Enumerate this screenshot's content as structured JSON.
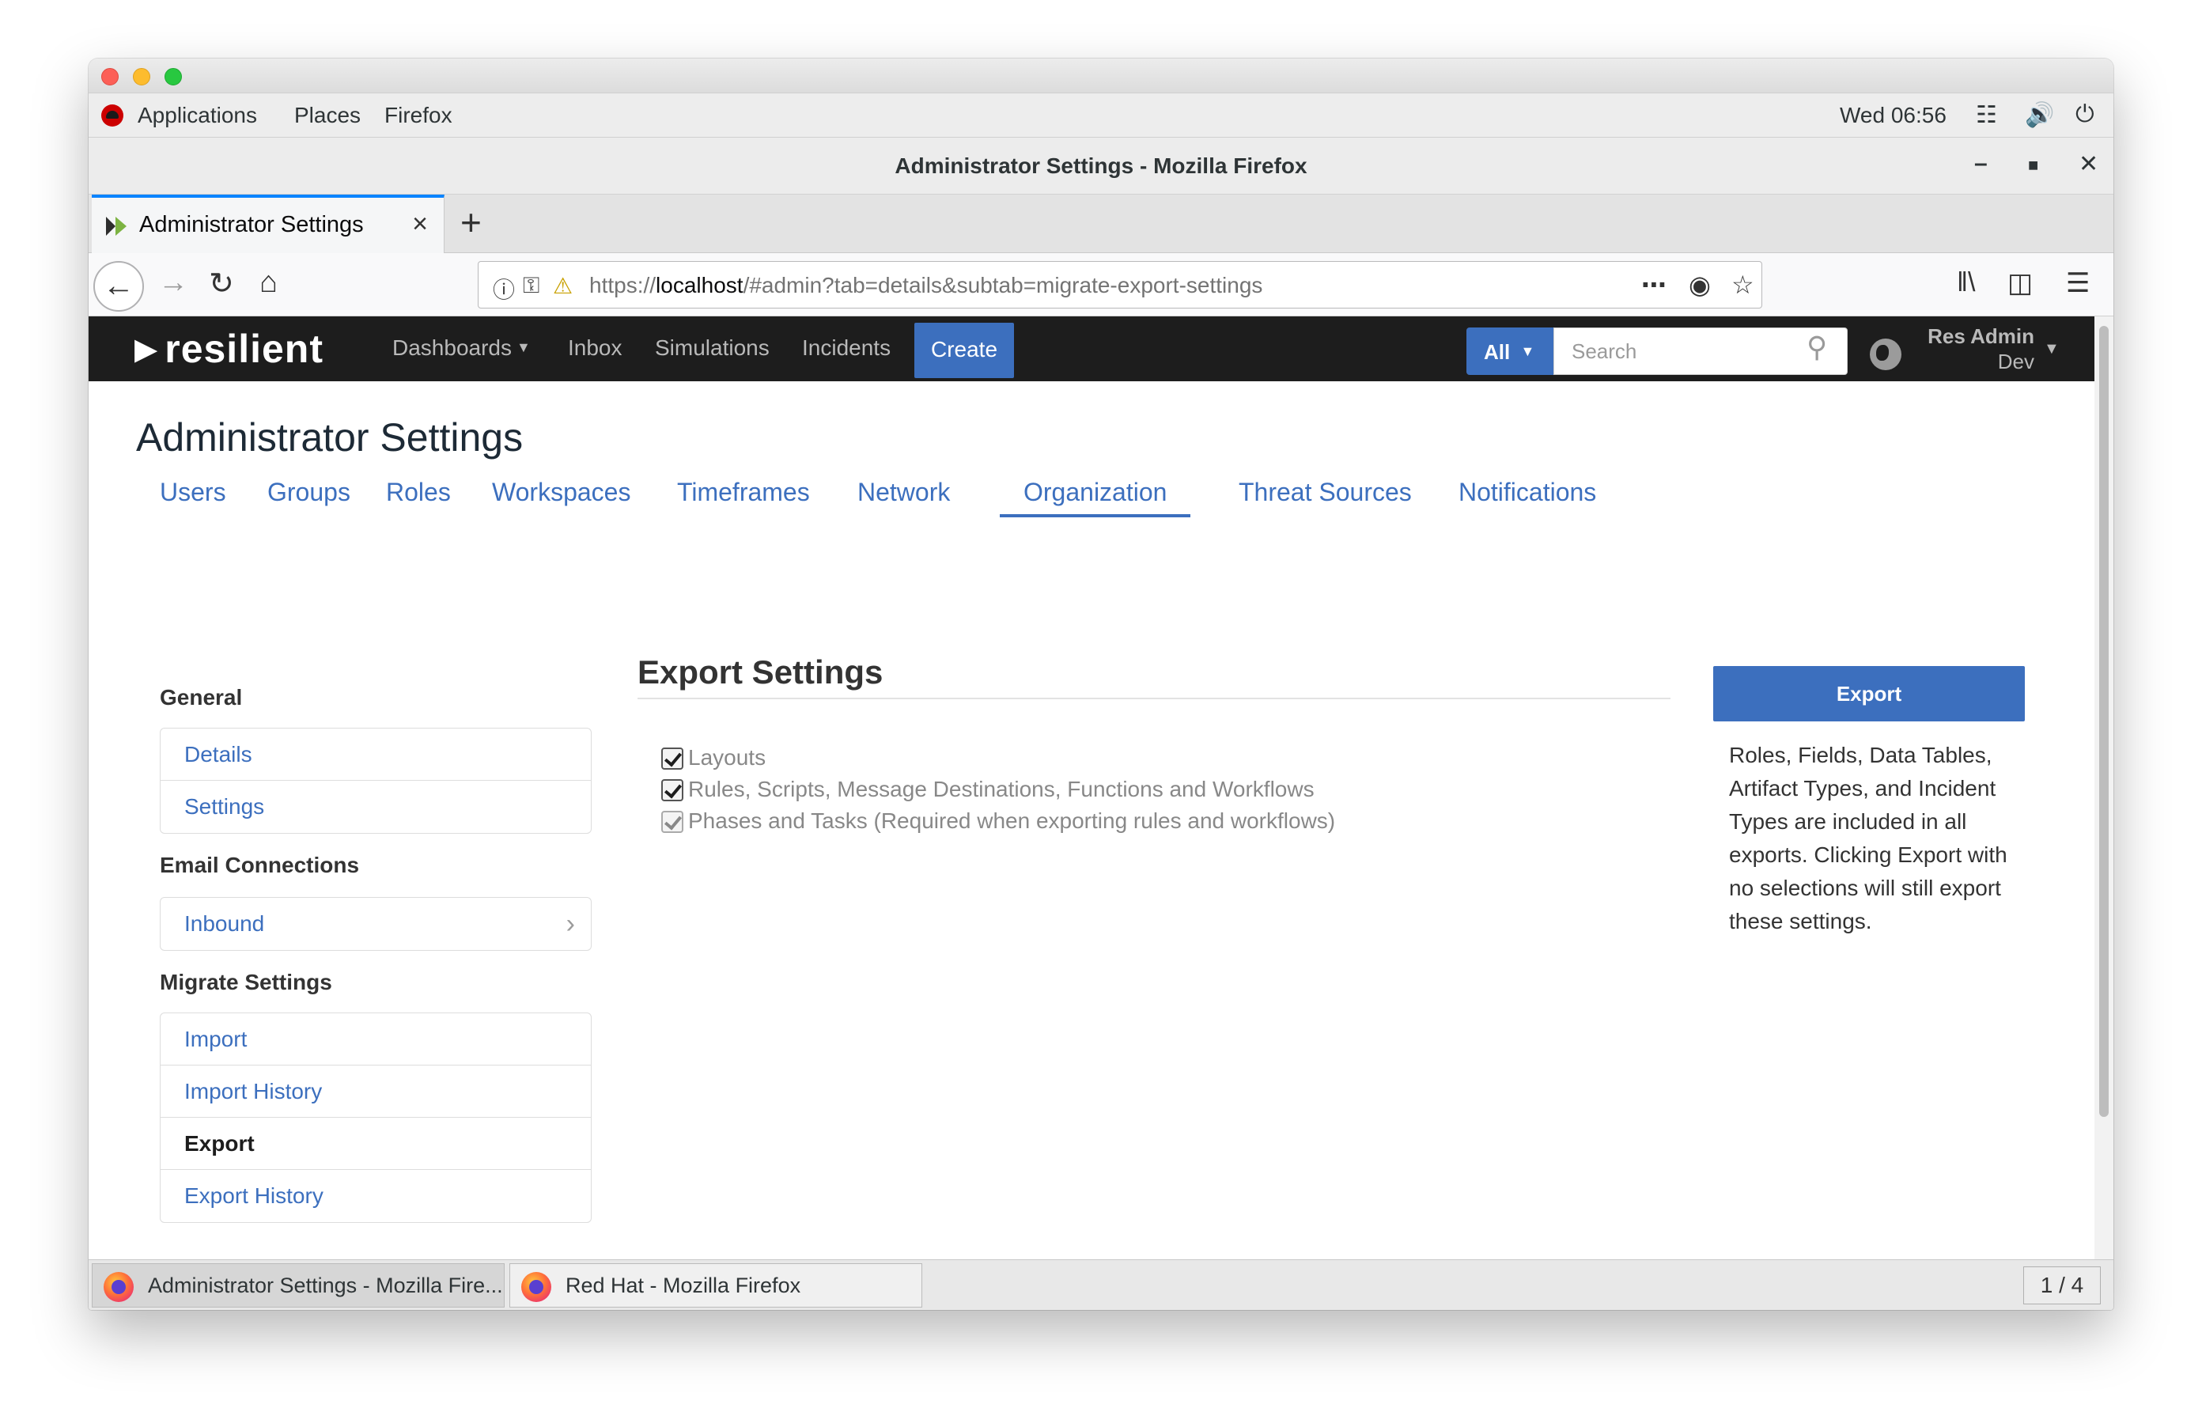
{
  "colors": {
    "accent": "#3c6fbe",
    "header_bg": "#1d1d1d",
    "traffic_red": "#fc5f57",
    "traffic_yellow": "#fdbc2e",
    "traffic_green": "#28c840"
  },
  "gnome": {
    "applications": "Applications",
    "places": "Places",
    "firefox": "Firefox",
    "clock": "Wed 06:56",
    "icons": [
      "network-icon",
      "volume-icon",
      "power-icon"
    ]
  },
  "firefox": {
    "window_title": "Administrator Settings - Mozilla Firefox",
    "tab_title": "Administrator Settings",
    "url_prefix": "https://",
    "url_host": "localhost",
    "url_path": "/#admin?tab=details&subtab=migrate-export-settings"
  },
  "header": {
    "logo": "resilient",
    "nav": [
      "Dashboards",
      "Inbox",
      "Simulations",
      "Incidents"
    ],
    "create": "Create",
    "search_scope": "All",
    "search_placeholder": "Search",
    "user_name": "Res Admin",
    "user_org": "Dev"
  },
  "page": {
    "title": "Administrator Settings",
    "tabs": [
      "Users",
      "Groups",
      "Roles",
      "Workspaces",
      "Timeframes",
      "Network",
      "Organization",
      "Threat Sources",
      "Notifications"
    ],
    "active_tab": "Organization"
  },
  "sidebar": {
    "general_heading": "General",
    "general_items": [
      "Details",
      "Settings"
    ],
    "email_heading": "Email Connections",
    "email_items": [
      "Inbound"
    ],
    "migrate_heading": "Migrate Settings",
    "migrate_items": [
      "Import",
      "Import History",
      "Export",
      "Export History"
    ],
    "active_item": "Export"
  },
  "export": {
    "title": "Export Settings",
    "options": [
      {
        "label": "Layouts",
        "checked": true,
        "disabled": false
      },
      {
        "label": "Rules, Scripts, Message Destinations, Functions and Workflows",
        "checked": true,
        "disabled": false
      },
      {
        "label": "Phases and Tasks (Required when exporting rules and workflows)",
        "checked": true,
        "disabled": true
      }
    ],
    "button": "Export",
    "note": "Roles, Fields, Data Tables, Artifact Types, and Incident Types are included in all exports. Clicking Export with no selections will still export these settings."
  },
  "taskbar": {
    "tasks": [
      "Administrator Settings - Mozilla Fire...",
      "Red Hat - Mozilla Firefox"
    ],
    "pager": "1 / 4"
  }
}
